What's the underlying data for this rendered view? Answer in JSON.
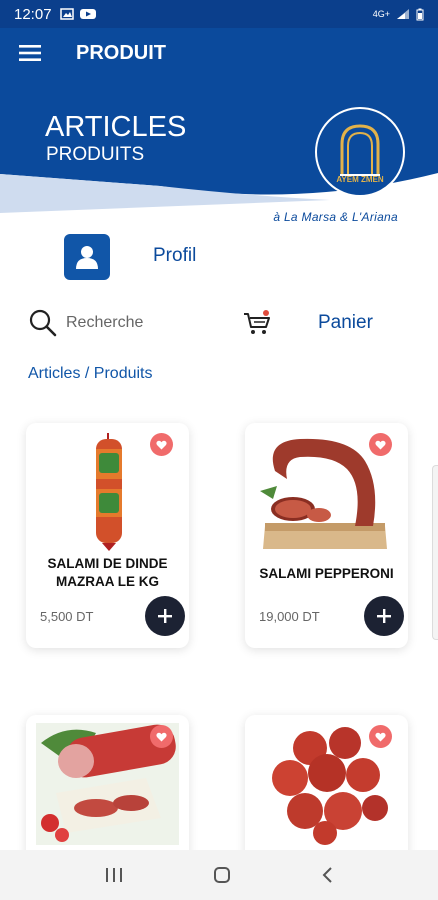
{
  "status_bar": {
    "time": "12:07",
    "network": "4G+"
  },
  "app_bar": {
    "title": "PRODUIT"
  },
  "banner": {
    "title": "ARTICLES",
    "subtitle": "PRODUITS",
    "brand_logo_text": "AYEM ZMEN",
    "tagline": "à La Marsa & L'Ariana",
    "colors": {
      "primary": "#0b4a9c",
      "accent_light": "#cfdcef"
    }
  },
  "profile": {
    "label": "Profil"
  },
  "search": {
    "placeholder": "Recherche"
  },
  "cart": {
    "label": "Panier"
  },
  "breadcrumb": "Articles / Produits",
  "products": [
    {
      "name": "SALAMI DE DINDE MAZRAA LE KG",
      "price": "5,500 DT",
      "image": "salami-roll"
    },
    {
      "name": "SALAMI PEPPERONI",
      "price": "19,000 DT",
      "image": "sausage-board"
    },
    {
      "name": "",
      "price": "",
      "image": "salami-platter"
    },
    {
      "name": "",
      "price": "",
      "image": "pepperoni-slices"
    }
  ],
  "icons": {
    "menu": "hamburger-icon",
    "profile": "user-icon",
    "search": "search-icon",
    "cart": "cart-icon",
    "favorite": "heart-icon",
    "add": "plus-icon"
  },
  "colors": {
    "fav_badge": "#f06b6b",
    "add_button": "#1c2233",
    "link": "#1156a8"
  }
}
